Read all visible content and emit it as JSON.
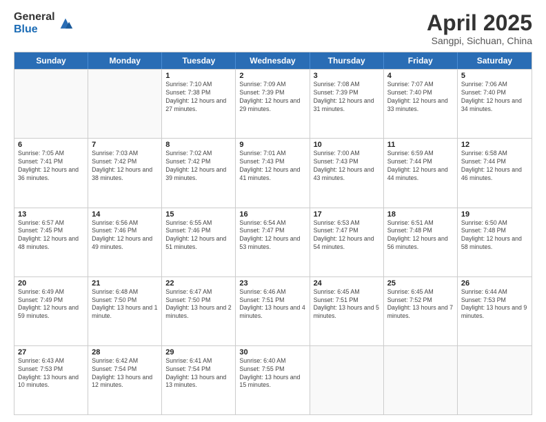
{
  "logo": {
    "general": "General",
    "blue": "Blue"
  },
  "title": "April 2025",
  "subtitle": "Sangpi, Sichuan, China",
  "days": [
    "Sunday",
    "Monday",
    "Tuesday",
    "Wednesday",
    "Thursday",
    "Friday",
    "Saturday"
  ],
  "weeks": [
    [
      {
        "day": "",
        "info": ""
      },
      {
        "day": "",
        "info": ""
      },
      {
        "day": "1",
        "info": "Sunrise: 7:10 AM\nSunset: 7:38 PM\nDaylight: 12 hours and 27 minutes."
      },
      {
        "day": "2",
        "info": "Sunrise: 7:09 AM\nSunset: 7:39 PM\nDaylight: 12 hours and 29 minutes."
      },
      {
        "day": "3",
        "info": "Sunrise: 7:08 AM\nSunset: 7:39 PM\nDaylight: 12 hours and 31 minutes."
      },
      {
        "day": "4",
        "info": "Sunrise: 7:07 AM\nSunset: 7:40 PM\nDaylight: 12 hours and 33 minutes."
      },
      {
        "day": "5",
        "info": "Sunrise: 7:06 AM\nSunset: 7:40 PM\nDaylight: 12 hours and 34 minutes."
      }
    ],
    [
      {
        "day": "6",
        "info": "Sunrise: 7:05 AM\nSunset: 7:41 PM\nDaylight: 12 hours and 36 minutes."
      },
      {
        "day": "7",
        "info": "Sunrise: 7:03 AM\nSunset: 7:42 PM\nDaylight: 12 hours and 38 minutes."
      },
      {
        "day": "8",
        "info": "Sunrise: 7:02 AM\nSunset: 7:42 PM\nDaylight: 12 hours and 39 minutes."
      },
      {
        "day": "9",
        "info": "Sunrise: 7:01 AM\nSunset: 7:43 PM\nDaylight: 12 hours and 41 minutes."
      },
      {
        "day": "10",
        "info": "Sunrise: 7:00 AM\nSunset: 7:43 PM\nDaylight: 12 hours and 43 minutes."
      },
      {
        "day": "11",
        "info": "Sunrise: 6:59 AM\nSunset: 7:44 PM\nDaylight: 12 hours and 44 minutes."
      },
      {
        "day": "12",
        "info": "Sunrise: 6:58 AM\nSunset: 7:44 PM\nDaylight: 12 hours and 46 minutes."
      }
    ],
    [
      {
        "day": "13",
        "info": "Sunrise: 6:57 AM\nSunset: 7:45 PM\nDaylight: 12 hours and 48 minutes."
      },
      {
        "day": "14",
        "info": "Sunrise: 6:56 AM\nSunset: 7:46 PM\nDaylight: 12 hours and 49 minutes."
      },
      {
        "day": "15",
        "info": "Sunrise: 6:55 AM\nSunset: 7:46 PM\nDaylight: 12 hours and 51 minutes."
      },
      {
        "day": "16",
        "info": "Sunrise: 6:54 AM\nSunset: 7:47 PM\nDaylight: 12 hours and 53 minutes."
      },
      {
        "day": "17",
        "info": "Sunrise: 6:53 AM\nSunset: 7:47 PM\nDaylight: 12 hours and 54 minutes."
      },
      {
        "day": "18",
        "info": "Sunrise: 6:51 AM\nSunset: 7:48 PM\nDaylight: 12 hours and 56 minutes."
      },
      {
        "day": "19",
        "info": "Sunrise: 6:50 AM\nSunset: 7:48 PM\nDaylight: 12 hours and 58 minutes."
      }
    ],
    [
      {
        "day": "20",
        "info": "Sunrise: 6:49 AM\nSunset: 7:49 PM\nDaylight: 12 hours and 59 minutes."
      },
      {
        "day": "21",
        "info": "Sunrise: 6:48 AM\nSunset: 7:50 PM\nDaylight: 13 hours and 1 minute."
      },
      {
        "day": "22",
        "info": "Sunrise: 6:47 AM\nSunset: 7:50 PM\nDaylight: 13 hours and 2 minutes."
      },
      {
        "day": "23",
        "info": "Sunrise: 6:46 AM\nSunset: 7:51 PM\nDaylight: 13 hours and 4 minutes."
      },
      {
        "day": "24",
        "info": "Sunrise: 6:45 AM\nSunset: 7:51 PM\nDaylight: 13 hours and 5 minutes."
      },
      {
        "day": "25",
        "info": "Sunrise: 6:45 AM\nSunset: 7:52 PM\nDaylight: 13 hours and 7 minutes."
      },
      {
        "day": "26",
        "info": "Sunrise: 6:44 AM\nSunset: 7:53 PM\nDaylight: 13 hours and 9 minutes."
      }
    ],
    [
      {
        "day": "27",
        "info": "Sunrise: 6:43 AM\nSunset: 7:53 PM\nDaylight: 13 hours and 10 minutes."
      },
      {
        "day": "28",
        "info": "Sunrise: 6:42 AM\nSunset: 7:54 PM\nDaylight: 13 hours and 12 minutes."
      },
      {
        "day": "29",
        "info": "Sunrise: 6:41 AM\nSunset: 7:54 PM\nDaylight: 13 hours and 13 minutes."
      },
      {
        "day": "30",
        "info": "Sunrise: 6:40 AM\nSunset: 7:55 PM\nDaylight: 13 hours and 15 minutes."
      },
      {
        "day": "",
        "info": ""
      },
      {
        "day": "",
        "info": ""
      },
      {
        "day": "",
        "info": ""
      }
    ]
  ]
}
